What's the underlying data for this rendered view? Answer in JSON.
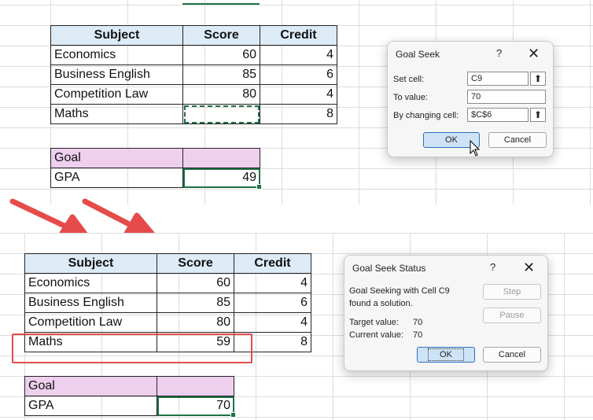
{
  "before": {
    "table": {
      "headers": [
        "Subject",
        "Score",
        "Credit"
      ],
      "rows": [
        {
          "subject": "Economics",
          "score": "60",
          "credit": "4"
        },
        {
          "subject": "Business English",
          "score": "85",
          "credit": "6"
        },
        {
          "subject": "Competition Law",
          "score": "80",
          "credit": "4"
        },
        {
          "subject": "Maths",
          "score": "",
          "credit": "8"
        }
      ]
    },
    "goal": {
      "header": "Goal",
      "label": "GPA",
      "value": "49"
    }
  },
  "goal_seek_dialog": {
    "title": "Goal Seek",
    "help": "?",
    "close": "✕",
    "set_cell_label": "Set cell:",
    "set_cell_value": "C9",
    "to_value_label": "To value:",
    "to_value_value": "70",
    "changing_cell_label": "By changing cell:",
    "changing_cell_value": "$C$6",
    "ok": "OK",
    "cancel": "Cancel"
  },
  "after": {
    "table": {
      "headers": [
        "Subject",
        "Score",
        "Credit"
      ],
      "rows": [
        {
          "subject": "Economics",
          "score": "60",
          "credit": "4"
        },
        {
          "subject": "Business English",
          "score": "85",
          "credit": "6"
        },
        {
          "subject": "Competition Law",
          "score": "80",
          "credit": "4"
        },
        {
          "subject": "Maths",
          "score": "59",
          "credit": "8"
        }
      ]
    },
    "goal": {
      "header": "Goal",
      "label": "GPA",
      "value": "70"
    }
  },
  "status_dialog": {
    "title": "Goal Seek Status",
    "help": "?",
    "close": "✕",
    "message_line1": "Goal Seeking with Cell C9",
    "message_line2": "found a solution.",
    "target_label": "Target value:",
    "target_value": "70",
    "current_label": "Current value:",
    "current_value": "70",
    "step": "Step",
    "pause": "Pause",
    "ok": "OK",
    "cancel": "Cancel"
  },
  "colors": {
    "arrow": "#e64b4b",
    "highlight": "#e64b4b",
    "header_fill": "#ddebf7",
    "goal_fill": "#eecfee",
    "selection": "#1e7145"
  }
}
